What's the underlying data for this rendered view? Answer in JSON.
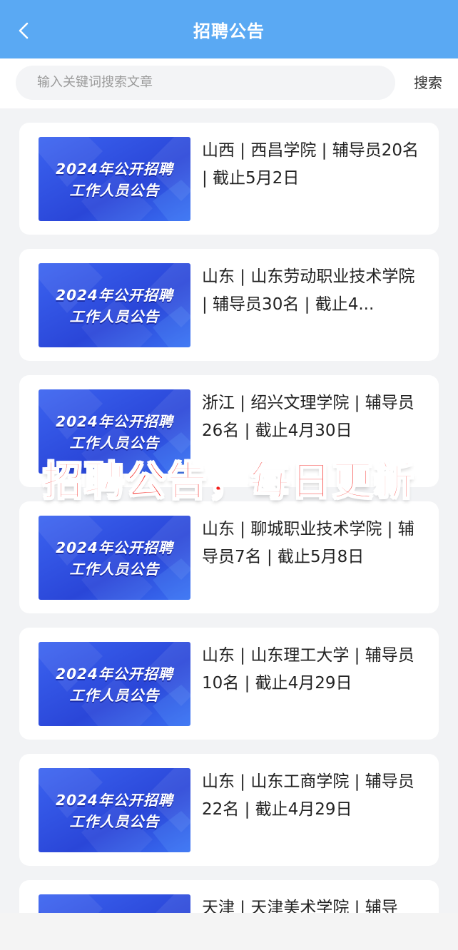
{
  "header": {
    "title": "招聘公告",
    "back_icon": "chevron-left-icon"
  },
  "search": {
    "placeholder": "输入关键词搜索文章",
    "button": "搜索"
  },
  "thumbnail": {
    "line1": "2024年公开招聘",
    "line2": "工作人员公告"
  },
  "articles": [
    {
      "title": "山西 | 西昌学院 | 辅导员20名 | 截止5月2日"
    },
    {
      "title": "山东 | 山东劳动职业技术学院 | 辅导员30名 | 截止4..."
    },
    {
      "title": "浙江 | 绍兴文理学院 | 辅导员26名 | 截止4月30日"
    },
    {
      "title": "山东 | 聊城职业技术学院 | 辅导员7名 | 截止5月8日"
    },
    {
      "title": "山东 | 山东理工大学 | 辅导员10名 | 截止4月29日"
    },
    {
      "title": "山东 | 山东工商学院 | 辅导员22名 | 截止4月29日"
    },
    {
      "title": "天津 | 天津美术学院 | 辅导"
    }
  ],
  "overlay_text": "招聘公告，每日更新",
  "colors": {
    "header_bg": "#5aa9f3",
    "overlay_red": "#f4201c",
    "thumb_blue": "#2a46d8"
  }
}
